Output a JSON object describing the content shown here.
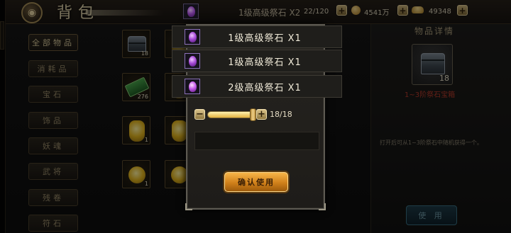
{
  "header": {
    "title": "背包",
    "back_icon": "swirl-back-icon",
    "capacity": "22/120",
    "copper": "4541万",
    "gold": "49348"
  },
  "categories": [
    "全部物品",
    "消耗品",
    "宝石",
    "饰品",
    "妖魂",
    "武将",
    "残卷",
    "符石"
  ],
  "grid": {
    "items": [
      {
        "icon": "chest-icon",
        "count": "18"
      },
      {
        "icon": "jade-scroll-icon",
        "count": "276"
      },
      {
        "icon": "gold-jade-icon",
        "count": "1"
      },
      {
        "icon": "gold-jade-icon",
        "count": "1"
      },
      {
        "icon": "gold-pendant-icon",
        "count": "1"
      },
      {
        "icon": "gold-pendant-icon",
        "count": "1"
      },
      {
        "icon": "gold-jade-icon",
        "count": ""
      },
      {
        "icon": "gold-jade-icon",
        "count": ""
      }
    ]
  },
  "detail": {
    "title": "物品详情",
    "item_count": "18",
    "item_name": "1~3阶祭石宝箱",
    "description": "打开后可从1~3阶祭石中随机获得一个。",
    "use_label": "使 用"
  },
  "ghost_row": {
    "label": "1级高级祭石 X2"
  },
  "options": [
    {
      "label": "1级高级祭石 X1"
    },
    {
      "label": "1级高级祭石 X1"
    },
    {
      "label": "2级高级祭石 X1"
    }
  ],
  "dialog": {
    "quantity": "18/18",
    "quantity_fraction": 1.0,
    "confirm_label": "确认使用"
  },
  "colors": {
    "accent_gold": "#e3b240",
    "gem_purple": "#a64ad6",
    "rare_red": "#b43a2a"
  }
}
